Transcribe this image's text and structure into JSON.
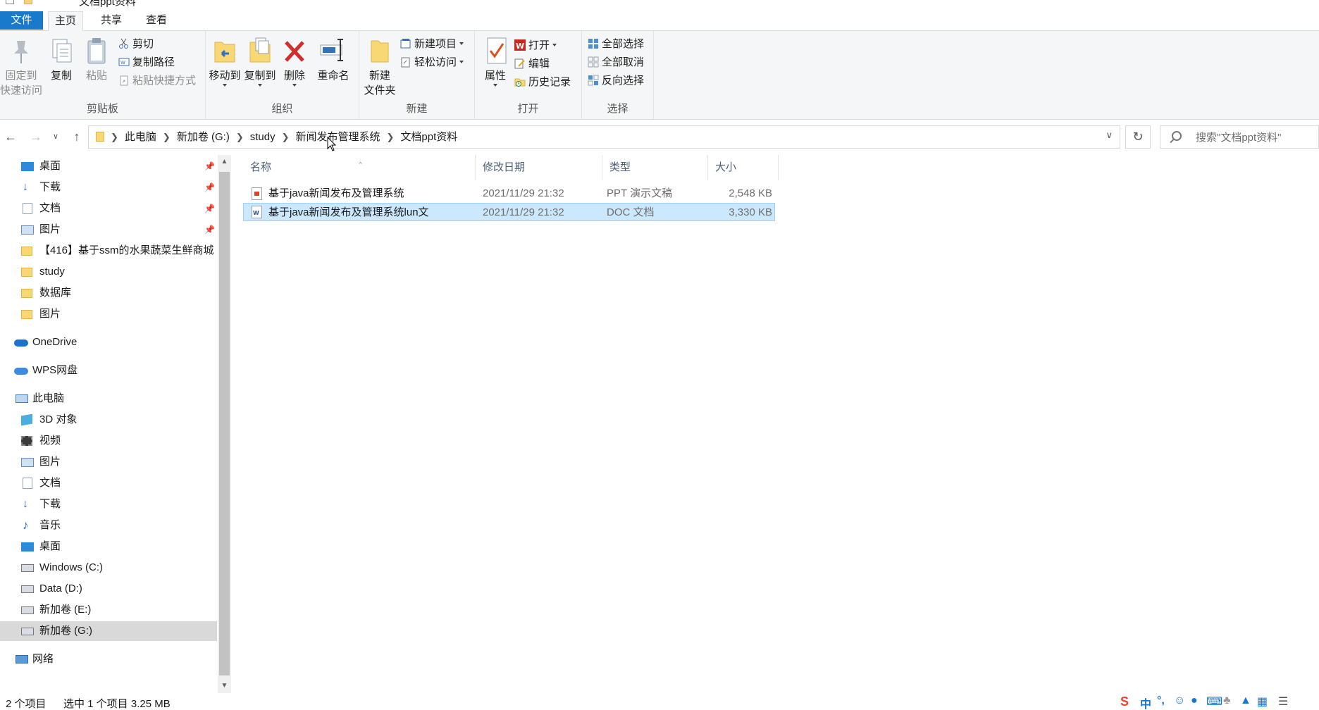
{
  "window": {
    "title": "文档ppt资料"
  },
  "ribbon_tabs": [
    {
      "label": "文件"
    },
    {
      "label": "主页"
    },
    {
      "label": "共享"
    },
    {
      "label": "查看"
    }
  ],
  "ribbon": {
    "clipboard": {
      "group_label": "剪贴板",
      "pin_line1": "固定到",
      "pin_line2": "快速访问",
      "copy": "复制",
      "paste": "粘贴",
      "cut": "剪切",
      "copy_path": "复制路径",
      "paste_shortcut": "粘贴快捷方式"
    },
    "organize": {
      "group_label": "组织",
      "move_to": "移动到",
      "copy_to": "复制到",
      "delete": "删除",
      "rename": "重命名"
    },
    "new": {
      "group_label": "新建",
      "new_folder_line1": "新建",
      "new_folder_line2": "文件夹",
      "new_item": "新建项目",
      "easy_access": "轻松访问"
    },
    "open": {
      "group_label": "打开",
      "properties": "属性",
      "open": "打开",
      "edit": "编辑",
      "history": "历史记录"
    },
    "select": {
      "group_label": "选择",
      "select_all": "全部选择",
      "select_none": "全部取消",
      "invert": "反向选择"
    }
  },
  "address": {
    "crumbs": [
      "此电脑",
      "新加卷 (G:)",
      "study",
      "新闻发布管理系统",
      "文档ppt资料"
    ]
  },
  "search": {
    "placeholder": "搜索\"文档ppt资料\""
  },
  "nav": {
    "quick": [
      {
        "label": "桌面"
      },
      {
        "label": "下载"
      },
      {
        "label": "文档"
      },
      {
        "label": "图片"
      },
      {
        "label": "【416】基于ssm的水果蔬菜生鲜商城"
      },
      {
        "label": "study"
      },
      {
        "label": "数据库"
      },
      {
        "label": "图片"
      }
    ],
    "onedrive": "OneDrive",
    "wps": "WPS网盘",
    "this_pc": "此电脑",
    "pc_items": [
      {
        "label": "3D 对象"
      },
      {
        "label": "视频"
      },
      {
        "label": "图片"
      },
      {
        "label": "文档"
      },
      {
        "label": "下载"
      },
      {
        "label": "音乐"
      },
      {
        "label": "桌面"
      },
      {
        "label": "Windows (C:)"
      },
      {
        "label": "Data (D:)"
      },
      {
        "label": "新加卷 (E:)"
      },
      {
        "label": "新加卷 (G:)"
      }
    ],
    "network": "网络"
  },
  "columns": {
    "name": "名称",
    "date": "修改日期",
    "type": "类型",
    "size": "大小"
  },
  "files": [
    {
      "name": "基于java新闻发布及管理系统",
      "date": "2021/11/29 21:32",
      "type": "PPT 演示文稿",
      "size": "2,548 KB",
      "selected": false
    },
    {
      "name": "基于java新闻发布及管理系统lun文",
      "date": "2021/11/29 21:32",
      "type": "DOC 文档",
      "size": "3,330 KB",
      "selected": true
    }
  ],
  "status": {
    "count": "2 个项目",
    "selection": "选中 1 个项目  3.25 MB"
  },
  "tray": {
    "ime": "中"
  },
  "colors": {
    "file_tab": "#1979ca",
    "selection": "#cce8ff",
    "selection_border": "#99d1ff",
    "ribbon_bg": "#f5f6f7"
  }
}
